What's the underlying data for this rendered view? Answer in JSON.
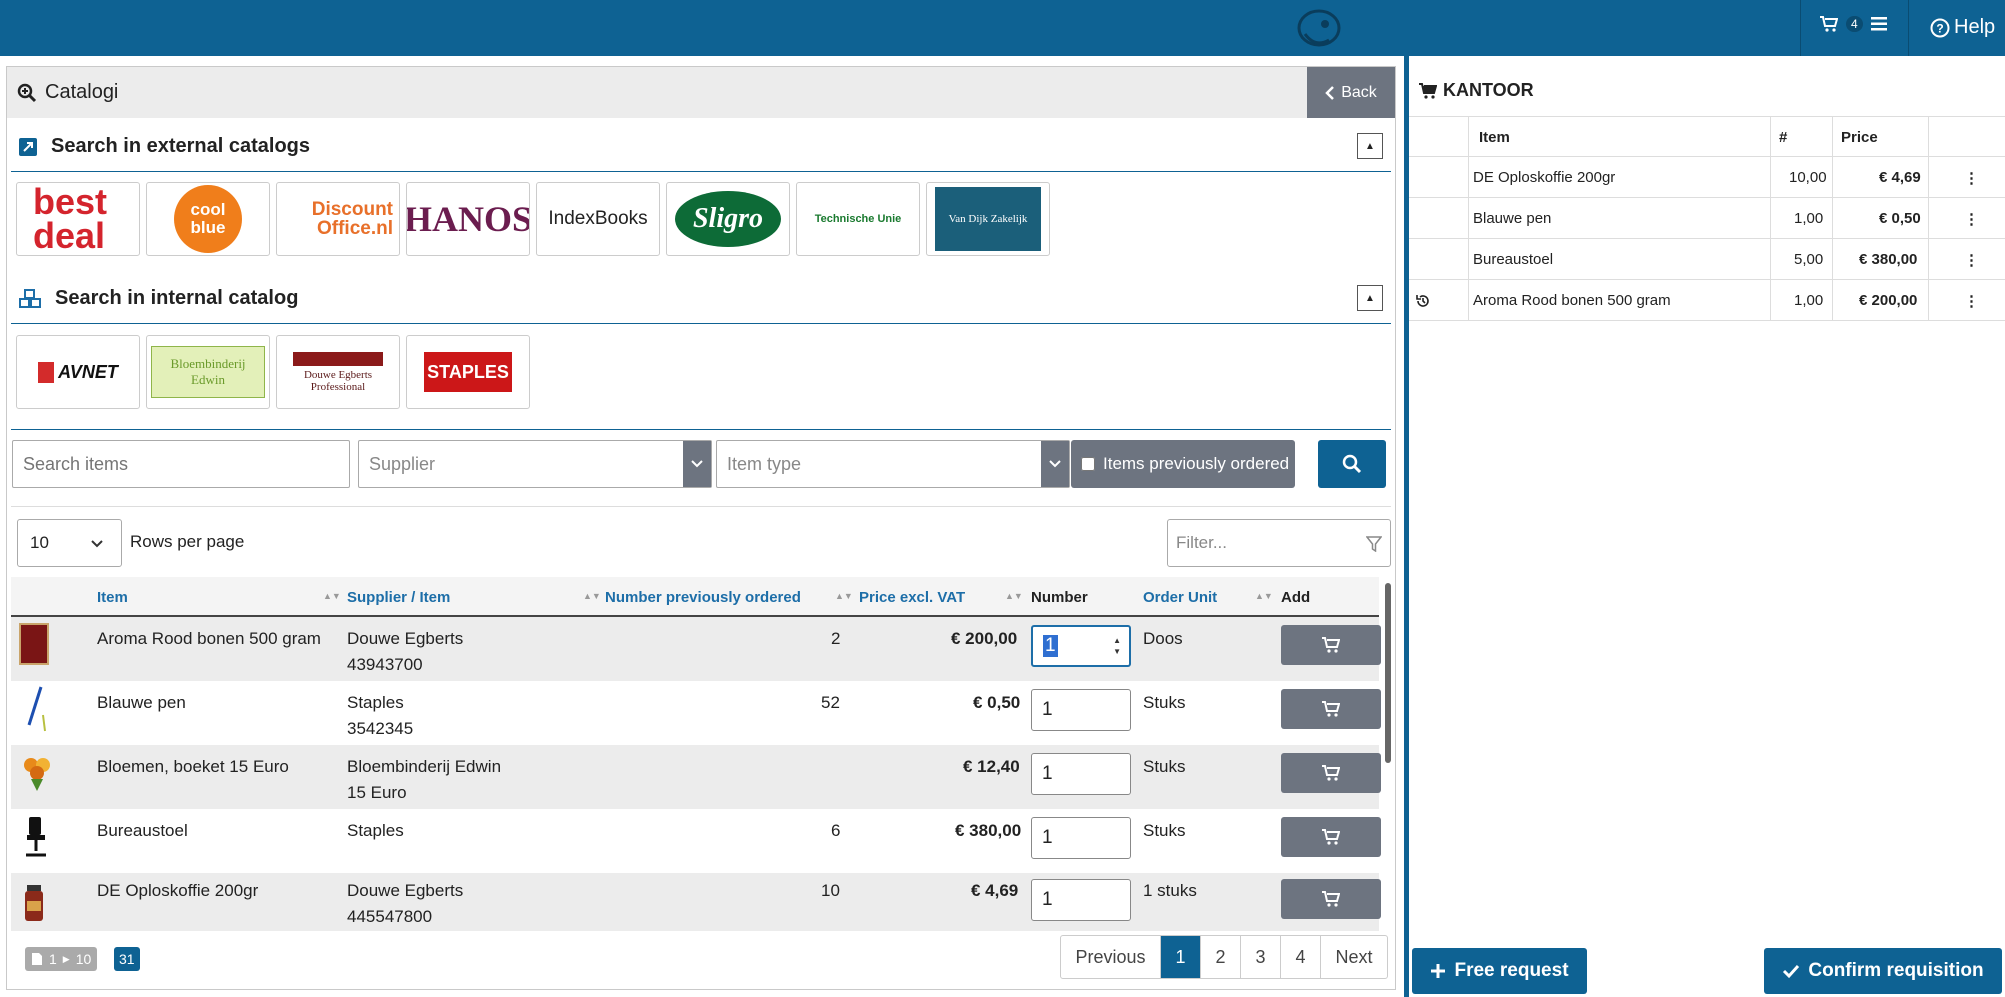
{
  "topbar": {
    "cart_count": "4",
    "help_label": "Help",
    "bg_color": "#0e6293"
  },
  "catalog": {
    "title": "Catalogi",
    "back_label": "Back",
    "external_title": "Search in external catalogs",
    "internal_title": "Search in internal catalog",
    "external_tiles": [
      "best deal",
      "cool blue",
      "Discount Office.nl",
      "HANOS",
      "IndexBooks",
      "Sligro",
      "Technische Unie",
      "Van Dijk Zakelijk"
    ],
    "internal_tiles": [
      "AVNET",
      "Bloembinderij Edwin",
      "Douwe Egberts Professional",
      "STAPLES"
    ]
  },
  "filters": {
    "search_placeholder": "Search items",
    "supplier_placeholder": "Supplier",
    "item_type_placeholder": "Item type",
    "previously_ordered_label": "Items previously ordered"
  },
  "table_controls": {
    "rows_value": "10",
    "rows_label": "Rows per page",
    "filter_placeholder": "Filter..."
  },
  "table": {
    "headers": {
      "item": "Item",
      "supplier": "Supplier / Item",
      "prev": "Number previously ordered",
      "price": "Price excl. VAT",
      "number": "Number",
      "unit": "Order Unit",
      "add": "Add"
    },
    "rows": [
      {
        "item": "Aroma Rood bonen 500 gram",
        "supplier": "Douwe Egberts",
        "code": "43943700",
        "prev": "2",
        "price": "€ 200,00",
        "qty": "1",
        "unit": "Doos"
      },
      {
        "item": "Blauwe pen",
        "supplier": "Staples",
        "code": "3542345",
        "prev": "52",
        "price": "€ 0,50",
        "qty": "1",
        "unit": "Stuks"
      },
      {
        "item": "Bloemen, boeket 15 Euro",
        "supplier": "Bloembinderij Edwin",
        "code": "15 Euro",
        "prev": "",
        "price": "€ 12,40",
        "qty": "1",
        "unit": "Stuks"
      },
      {
        "item": "Bureaustoel",
        "supplier": "Staples",
        "code": "",
        "prev": "6",
        "price": "€ 380,00",
        "qty": "1",
        "unit": "Stuks"
      },
      {
        "item": "DE Oploskoffie 200gr",
        "supplier": "Douwe Egberts",
        "code": "445547800",
        "prev": "10",
        "price": "€ 4,69",
        "qty": "1",
        "unit": "1 stuks"
      }
    ]
  },
  "pagination": {
    "range_from": "1",
    "range_to": "10",
    "total": "31",
    "prev_label": "Previous",
    "pages": [
      "1",
      "2",
      "3",
      "4"
    ],
    "next_label": "Next"
  },
  "cart": {
    "title": "KANTOOR",
    "headers": {
      "item": "Item",
      "count": "#",
      "price": "Price"
    },
    "rows": [
      {
        "item": "DE Oploskoffie 200gr",
        "count": "10,00",
        "price": "€ 4,69",
        "history": false
      },
      {
        "item": "Blauwe pen",
        "count": "1,00",
        "price": "€ 0,50",
        "history": false
      },
      {
        "item": "Bureaustoel",
        "count": "5,00",
        "price": "€ 380,00",
        "history": false
      },
      {
        "item": "Aroma Rood bonen 500 gram",
        "count": "1,00",
        "price": "€ 200,00",
        "history": true
      }
    ],
    "free_request_label": "Free request",
    "confirm_label": "Confirm requisition"
  }
}
